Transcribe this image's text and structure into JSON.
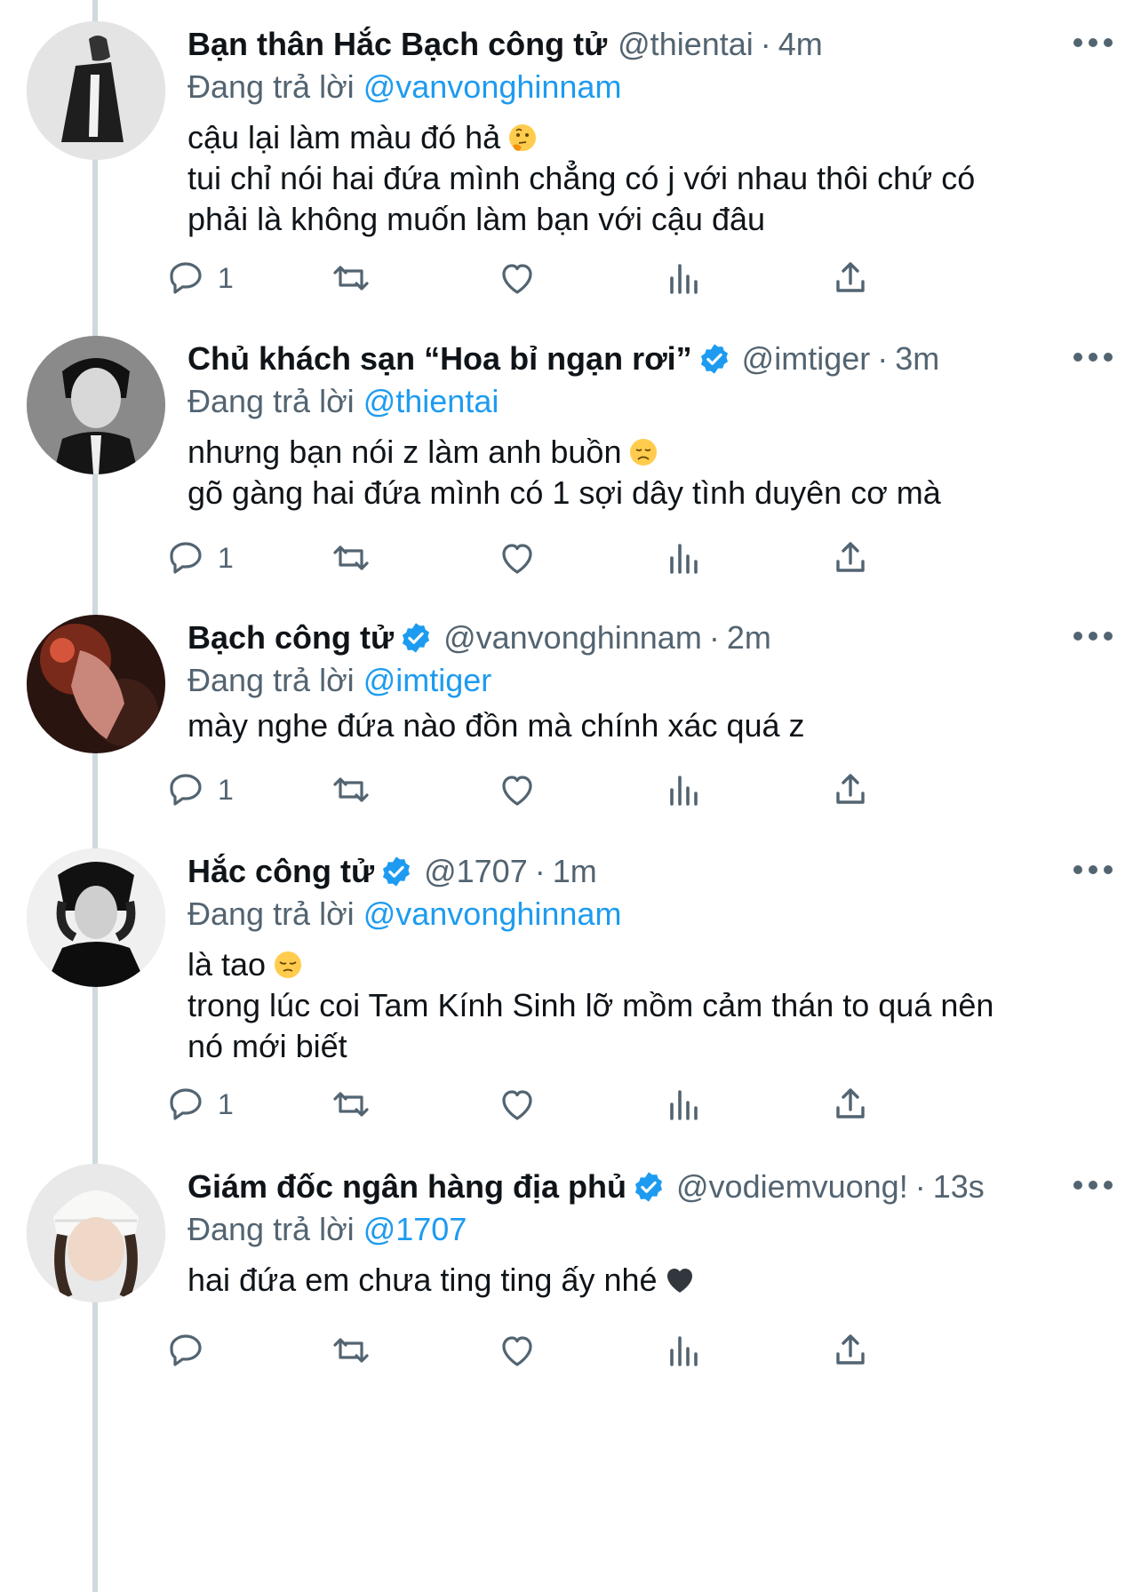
{
  "colors": {
    "link": "#1d9bf0",
    "muted": "#536471",
    "text": "#0f1419",
    "verified": "#1d9bf0"
  },
  "tweets": [
    {
      "name": "Bạn thân Hắc Bạch công tử",
      "verified": false,
      "handle": "@thientai",
      "separator": "·",
      "time": "4m",
      "replying_prefix": "Đang trả lời",
      "replying_to": "@vanvonghinnam",
      "lines": [
        "cậu lại làm màu đó hả",
        "tui chỉ nói hai đứa mình chẳng có j với nhau thôi chứ có",
        "phải là không muốn làm bạn với cậu đâu"
      ],
      "emoji": "thinking-face",
      "reply_count": "1"
    },
    {
      "name": "Chủ khách sạn “Hoa bỉ ngạn rơi”",
      "verified": true,
      "handle": "@imtiger",
      "separator": "·",
      "time": "3m",
      "replying_prefix": "Đang trả lời",
      "replying_to": "@thientai",
      "lines": [
        "nhưng bạn nói z làm anh buồn",
        "gõ gàng hai đứa mình có 1 sợi dây tình duyên cơ mà"
      ],
      "emoji": "disappointed-face",
      "reply_count": "1"
    },
    {
      "name": "Bạch công tử",
      "verified": true,
      "handle": "@vanvonghinnam",
      "separator": "·",
      "time": "2m",
      "replying_prefix": "Đang trả lời",
      "replying_to": "@imtiger",
      "lines": [
        "mày nghe đứa nào đồn mà chính xác quá z"
      ],
      "emoji": "",
      "reply_count": "1"
    },
    {
      "name": "Hắc công tử",
      "verified": true,
      "handle": "@1707",
      "separator": "·",
      "time": "1m",
      "replying_prefix": "Đang trả lời",
      "replying_to": "@vanvonghinnam",
      "lines": [
        "là tao",
        "trong lúc coi Tam Kính Sinh lỡ mồm cảm thán to quá nên",
        "nó mới biết"
      ],
      "emoji": "pensive-face",
      "reply_count": "1"
    },
    {
      "name": "Giám đốc ngân hàng địa phủ",
      "verified": true,
      "handle": "@vodiemvuong!",
      "separator": "·",
      "time": "13s",
      "replying_prefix": "Đang trả lời",
      "replying_to": "@1707",
      "lines": [
        "hai đứa em chưa ting ting ấy nhé"
      ],
      "emoji": "black-heart",
      "reply_count": ""
    }
  ]
}
